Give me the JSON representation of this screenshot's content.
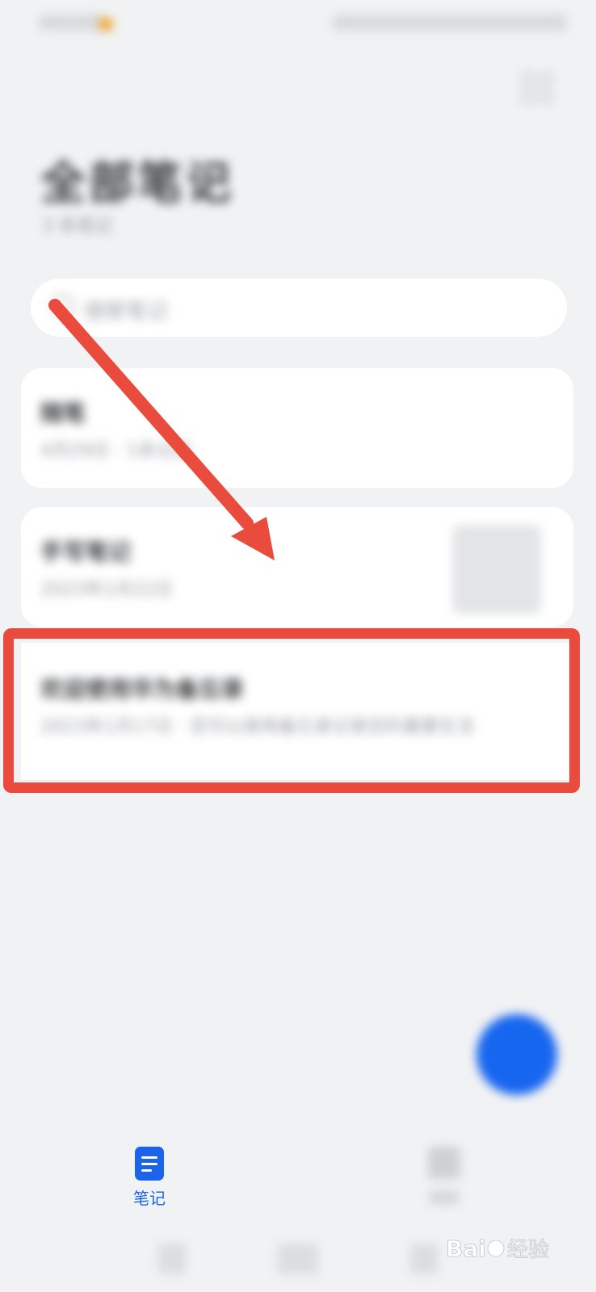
{
  "header": {
    "title": "全部笔记",
    "subtitle": "3 条笔记"
  },
  "search": {
    "placeholder": "搜索笔记"
  },
  "notes": [
    {
      "title": "随笔",
      "meta": "4月29日 · 1条记录"
    },
    {
      "title": "手写笔记",
      "meta": "2023年1月22日"
    },
    {
      "title": "欢迎使用华为备忘录",
      "meta": "2023年1月17日 · 您可以使用备忘录记录您的重要生活"
    }
  ],
  "bottom_nav": {
    "notes_label": "笔记"
  },
  "colors": {
    "accent": "#1a63ea",
    "highlight": "#e94b3c",
    "fab": "#1766ef"
  },
  "icons": {
    "notes_tab": "document-icon",
    "fab": "add-note-icon",
    "grid": "grid-view-icon"
  }
}
